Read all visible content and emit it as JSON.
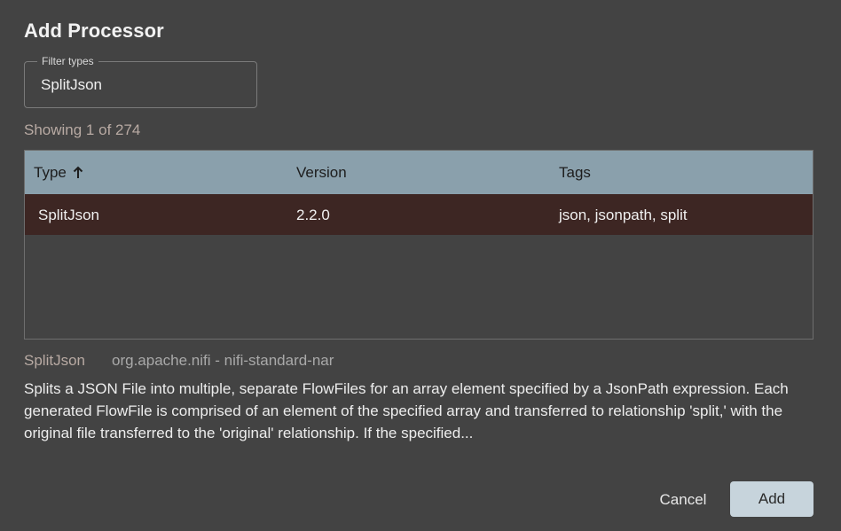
{
  "dialog": {
    "title": "Add Processor"
  },
  "filter": {
    "label": "Filter types",
    "value": "SplitJson"
  },
  "results": {
    "showing_text": "Showing 1 of 274"
  },
  "table": {
    "columns": [
      "Type",
      "Version",
      "Tags"
    ],
    "sort_icon": "arrow-up-icon",
    "rows": [
      {
        "type": "SplitJson",
        "version": "2.2.0",
        "tags": "json, jsonpath, split",
        "selected": true
      }
    ]
  },
  "details": {
    "name": "SplitJson",
    "bundle": "org.apache.nifi - nifi-standard-nar",
    "description": "Splits a JSON File into multiple, separate FlowFiles for an array element specified by a JsonPath expression. Each generated FlowFile is comprised of an element of the specified array and transferred to relationship 'split,' with the original file transferred to the 'original' relationship. If the specified..."
  },
  "actions": {
    "cancel_label": "Cancel",
    "add_label": "Add"
  },
  "colors": {
    "background": "#434343",
    "header_bg": "#8aa0ac",
    "selected_row_bg": "#3d2623",
    "add_button_bg": "#c7d4dc",
    "muted_text": "#b8aaa3"
  }
}
